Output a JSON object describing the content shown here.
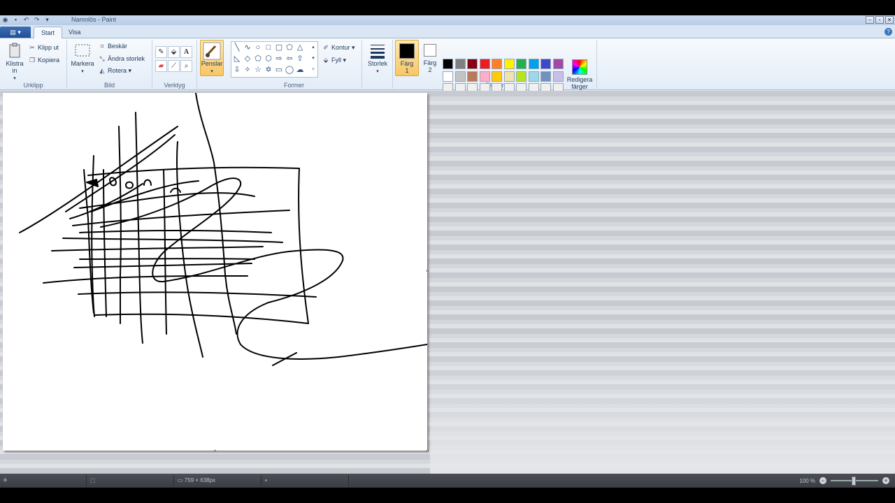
{
  "window": {
    "title": "Namnlös - Paint",
    "controls": {
      "minimize": "–",
      "maximize": "▫",
      "close": "✕"
    }
  },
  "quick_access": {
    "save_icon": "save-icon",
    "undo_icon": "undo-icon",
    "redo_icon": "redo-icon",
    "dropdown_icon": "chevron-down-icon"
  },
  "tabs": [
    {
      "label": "Start"
    },
    {
      "label": "Visa"
    }
  ],
  "help": "?",
  "ribbon": {
    "clipboard": {
      "paste": "Klistra in",
      "cut": "Klipp ut",
      "copy": "Kopiera",
      "group": "Urklipp"
    },
    "image": {
      "select": "Markera",
      "crop": "Beskär",
      "resize": "Ändra storlek",
      "rotate": "Rotera",
      "group": "Bild"
    },
    "tools": {
      "group": "Verktyg",
      "text": "A"
    },
    "brushes": {
      "label": "Penslar"
    },
    "shapes": {
      "outline": "Kontur",
      "fill": "Fyll",
      "group": "Former"
    },
    "size": {
      "label": "Storlek"
    },
    "colors": {
      "color1_line1": "Färg",
      "color1_line2": "1",
      "color2_line1": "Färg",
      "color2_line2": "2",
      "edit_line1": "Redigera",
      "edit_line2": "färger",
      "group": "Färger",
      "color1": "#000000",
      "color2": "#ffffff",
      "palette_row1": [
        "#000000",
        "#7f7f7f",
        "#880015",
        "#ed1c24",
        "#ff7f27",
        "#fff200",
        "#22b14c",
        "#00a2e8",
        "#3f48cc",
        "#a349a4"
      ],
      "palette_row2": [
        "#ffffff",
        "#c3c3c3",
        "#b97a57",
        "#ffaec9",
        "#ffc90e",
        "#efe4b0",
        "#b5e61d",
        "#99d9ea",
        "#7092be",
        "#c8bfe7"
      ],
      "palette_row3": [
        "#f0f0f0",
        "#f0f0f0",
        "#f0f0f0",
        "#f0f0f0",
        "#f0f0f0",
        "#f0f0f0",
        "#f0f0f0",
        "#f0f0f0",
        "#f0f0f0",
        "#f0f0f0"
      ]
    }
  },
  "status": {
    "size": "759 × 638px",
    "zoom": "100 %"
  }
}
